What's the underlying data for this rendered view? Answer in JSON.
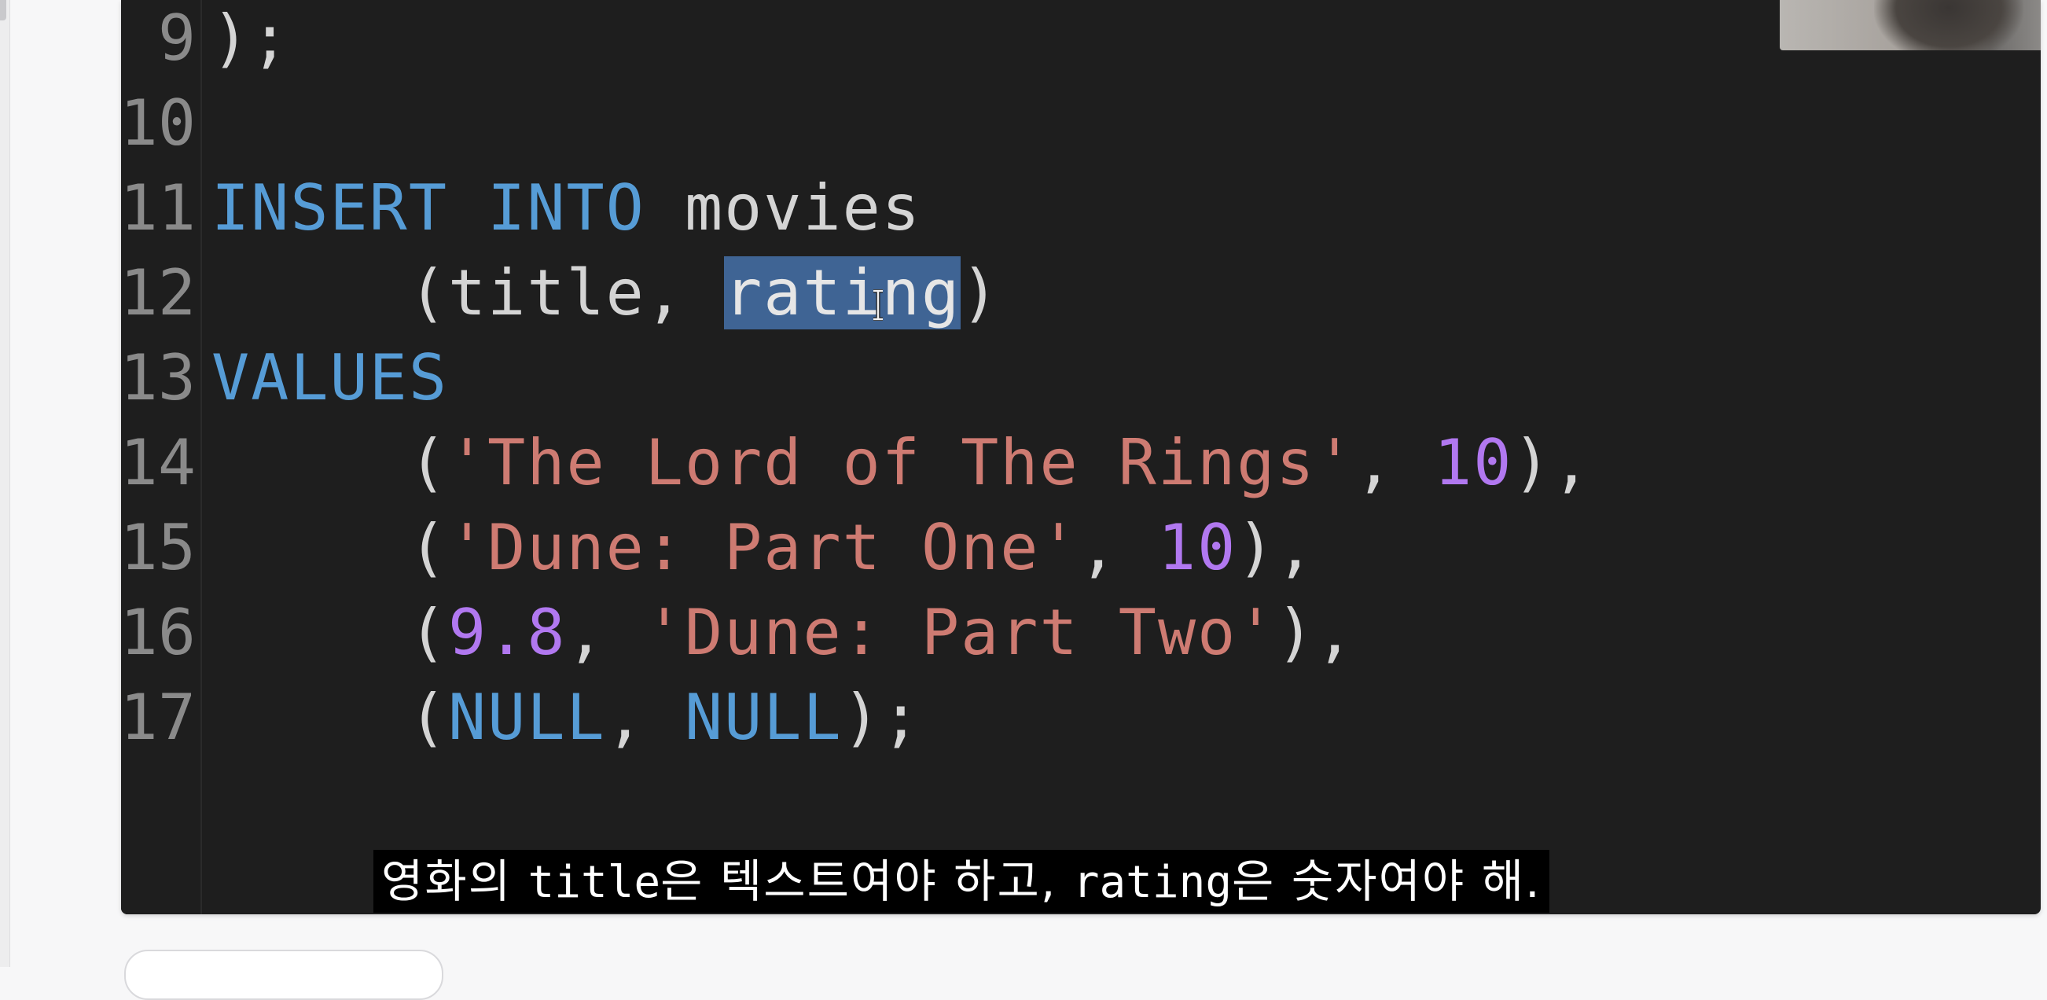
{
  "editor": {
    "lines": [
      {
        "number": "9",
        "tokens": [
          {
            "t": ");",
            "c": "id"
          }
        ]
      },
      {
        "number": "10",
        "tokens": []
      },
      {
        "number": "11",
        "tokens": [
          {
            "t": "INSERT",
            "c": "kw"
          },
          {
            "t": " ",
            "c": "id"
          },
          {
            "t": "INTO",
            "c": "kw"
          },
          {
            "t": " movies",
            "c": "id"
          }
        ]
      },
      {
        "number": "12",
        "tokens": [
          {
            "t": "     (title, ",
            "c": "id"
          },
          {
            "t": "rating",
            "c": "sel"
          },
          {
            "t": ")",
            "c": "id"
          }
        ]
      },
      {
        "number": "13",
        "tokens": [
          {
            "t": "VALUES",
            "c": "kw"
          }
        ]
      },
      {
        "number": "14",
        "tokens": [
          {
            "t": "     (",
            "c": "id"
          },
          {
            "t": "'The Lord of The Rings'",
            "c": "str"
          },
          {
            "t": ", ",
            "c": "id"
          },
          {
            "t": "10",
            "c": "num"
          },
          {
            "t": "),",
            "c": "id"
          }
        ]
      },
      {
        "number": "15",
        "tokens": [
          {
            "t": "     (",
            "c": "id"
          },
          {
            "t": "'Dune: Part One'",
            "c": "str"
          },
          {
            "t": ", ",
            "c": "id"
          },
          {
            "t": "10",
            "c": "num"
          },
          {
            "t": "),",
            "c": "id"
          }
        ]
      },
      {
        "number": "16",
        "tokens": [
          {
            "t": "     (",
            "c": "id"
          },
          {
            "t": "9.8",
            "c": "num"
          },
          {
            "t": ", ",
            "c": "id"
          },
          {
            "t": "'Dune: Part Two'",
            "c": "str"
          },
          {
            "t": "),",
            "c": "id"
          }
        ]
      },
      {
        "number": "17",
        "tokens": [
          {
            "t": "     (",
            "c": "id"
          },
          {
            "t": "NULL",
            "c": "kw"
          },
          {
            "t": ", ",
            "c": "id"
          },
          {
            "t": "NULL",
            "c": "kw"
          },
          {
            "t": ");",
            "c": "id"
          }
        ]
      }
    ],
    "selected_word": "rating",
    "colors": {
      "background": "#1e1e1e",
      "keyword": "#569cd6",
      "string": "#ce7b72",
      "number": "#b178f0",
      "identifier": "#d4d4d4",
      "selection": "#3f6494",
      "line_number": "#8a8a8a"
    }
  },
  "subtitle": {
    "segments": [
      {
        "t": "영화의 ",
        "mono": false
      },
      {
        "t": "title",
        "mono": true
      },
      {
        "t": "은 텍스트여야 하고, ",
        "mono": false
      },
      {
        "t": "rating",
        "mono": true
      },
      {
        "t": "은 숫자여야 해.",
        "mono": false
      }
    ]
  },
  "webcam": {
    "icon": "webcam-video-overlay"
  },
  "cursor": {
    "icon": "text-cursor-ibeam-icon"
  }
}
